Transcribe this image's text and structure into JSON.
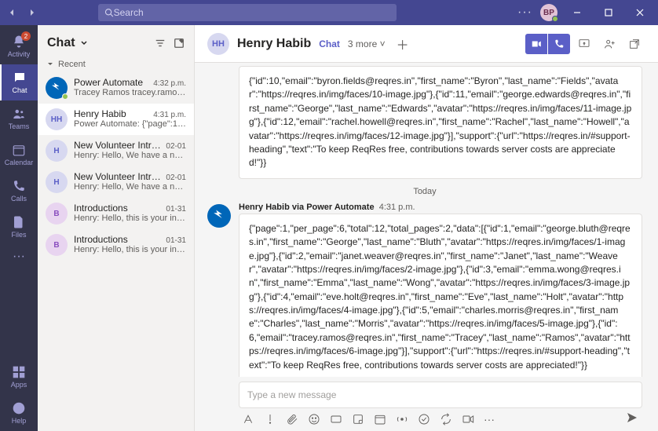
{
  "titlebar": {
    "search_placeholder": "Search",
    "avatar_initials": "BP"
  },
  "rail": {
    "items": [
      {
        "label": "Activity",
        "badge": "2"
      },
      {
        "label": "Chat"
      },
      {
        "label": "Teams"
      },
      {
        "label": "Calendar"
      },
      {
        "label": "Calls"
      },
      {
        "label": "Files"
      }
    ],
    "apps": "Apps",
    "help": "Help"
  },
  "chatlist": {
    "title": "Chat",
    "section": "Recent",
    "rows": [
      {
        "avatar": "PA",
        "cls": "pa",
        "name": "Power Automate",
        "time": "4:32 p.m.",
        "preview": "Tracey Ramos tracey.ramos@…"
      },
      {
        "avatar": "HH",
        "cls": "hh",
        "name": "Henry Habib",
        "time": "4:31 p.m.",
        "preview": "Power Automate: {\"page\":1,\"pe…"
      },
      {
        "avatar": "H",
        "cls": "h",
        "name": "New Volunteer Introduct…",
        "time": "02-01",
        "preview": "Henry: Hello, We have a new vol…"
      },
      {
        "avatar": "H",
        "cls": "h",
        "name": "New Volunteer Introduct…",
        "time": "02-01",
        "preview": "Henry: Hello, We have a new vol…"
      },
      {
        "avatar": "B",
        "cls": "b",
        "name": "Introductions",
        "time": "01-31",
        "preview": "Henry: Hello, this is your introdu…"
      },
      {
        "avatar": "B",
        "cls": "b",
        "name": "Introductions",
        "time": "01-31",
        "preview": "Henry: Hello, this is your introdu…"
      }
    ]
  },
  "conversation": {
    "avatar": "HH",
    "title": "Henry Habib",
    "tab": "Chat",
    "more": "3 more",
    "date_label": "Today",
    "prev_msg_body": "{\"id\":10,\"email\":\"byron.fields@reqres.in\",\"first_name\":\"Byron\",\"last_name\":\"Fields\",\"avatar\":\"https://reqres.in/img/faces/10-image.jpg\"},{\"id\":11,\"email\":\"george.edwards@reqres.in\",\"first_name\":\"George\",\"last_name\":\"Edwards\",\"avatar\":\"https://reqres.in/img/faces/11-image.jpg\"},{\"id\":12,\"email\":\"rachel.howell@reqres.in\",\"first_name\":\"Rachel\",\"last_name\":\"Howell\",\"avatar\":\"https://reqres.in/img/faces/12-image.jpg\"}],\"support\":{\"url\":\"https://reqres.in/#support-heading\",\"text\":\"To keep ReqRes free, contributions towards server costs are appreciated!\"}}",
    "msg_sender": "Henry Habib via Power Automate",
    "msg_time": "4:31 p.m.",
    "msg_body": "{\"page\":1,\"per_page\":6,\"total\":12,\"total_pages\":2,\"data\":[{\"id\":1,\"email\":\"george.bluth@reqres.in\",\"first_name\":\"George\",\"last_name\":\"Bluth\",\"avatar\":\"https://reqres.in/img/faces/1-image.jpg\"},{\"id\":2,\"email\":\"janet.weaver@reqres.in\",\"first_name\":\"Janet\",\"last_name\":\"Weaver\",\"avatar\":\"https://reqres.in/img/faces/2-image.jpg\"},{\"id\":3,\"email\":\"emma.wong@reqres.in\",\"first_name\":\"Emma\",\"last_name\":\"Wong\",\"avatar\":\"https://reqres.in/img/faces/3-image.jpg\"},{\"id\":4,\"email\":\"eve.holt@reqres.in\",\"first_name\":\"Eve\",\"last_name\":\"Holt\",\"avatar\":\"https://reqres.in/img/faces/4-image.jpg\"},{\"id\":5,\"email\":\"charles.morris@reqres.in\",\"first_name\":\"Charles\",\"last_name\":\"Morris\",\"avatar\":\"https://reqres.in/img/faces/5-image.jpg\"},{\"id\":6,\"email\":\"tracey.ramos@reqres.in\",\"first_name\":\"Tracey\",\"last_name\":\"Ramos\",\"avatar\":\"https://reqres.in/img/faces/6-image.jpg\"}],\"support\":{\"url\":\"https://reqres.in/#support-heading\",\"text\":\"To keep ReqRes free, contributions towards server costs are appreciated!\"}}"
  },
  "compose": {
    "placeholder": "Type a new message"
  }
}
